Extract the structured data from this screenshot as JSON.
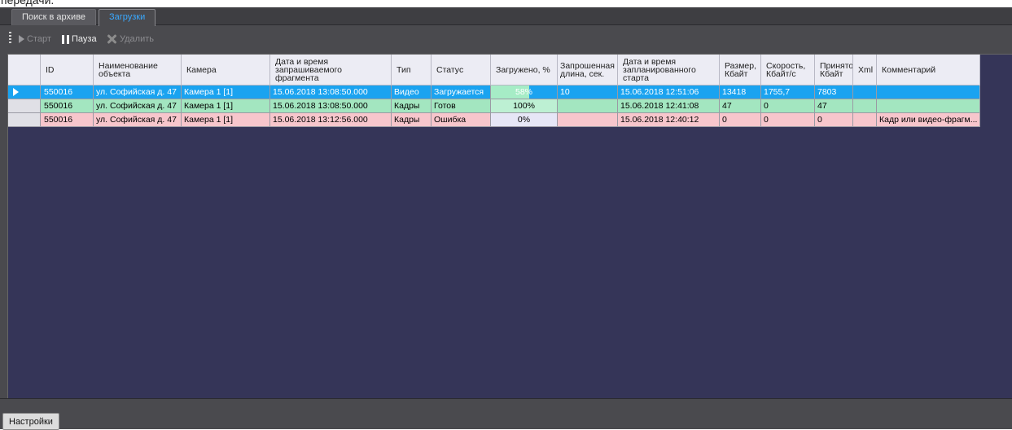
{
  "tabs": [
    {
      "label": "Поиск в архиве"
    },
    {
      "label": "Загрузки"
    }
  ],
  "toolbar": {
    "start_label": "Старт",
    "pause_label": "Пауза",
    "delete_label": "Удалить"
  },
  "table": {
    "columns": [
      "ID",
      "Наименование\nобъекта",
      "Камера",
      "Дата и время\nзапрашиваемого\nфрагмента",
      "Тип",
      "Статус",
      "Загружено, %",
      "Запрошенная\nдлина, сек.",
      "Дата и время\nзапланированного\nстарта",
      "Размер,\nКбайт",
      "Скорость,\nКбайт/с",
      "Принято,\nКбайт",
      "Xml",
      "Комментарий"
    ],
    "rows": [
      {
        "id": "550016",
        "object": "ул. Софийская д. 47",
        "camera": "Камера 1 [1]",
        "fragment_time": "15.06.2018 13:08:50.000",
        "type": "Видео",
        "status": "Загружается",
        "progress_label": "58%",
        "progress": 0.58,
        "duration": "10",
        "planned_start": "15.06.2018 12:51:06",
        "size": "13418",
        "speed": "1755,7",
        "received": "7803",
        "xml": "",
        "comment": ""
      },
      {
        "id": "550016",
        "object": "ул. Софийская д. 47",
        "camera": "Камера 1 [1]",
        "fragment_time": "15.06.2018 13:08:50.000",
        "type": "Кадры",
        "status": "Готов",
        "progress_label": "100%",
        "progress": 1.0,
        "duration": "",
        "planned_start": "15.06.2018 12:41:08",
        "size": "47",
        "speed": "0",
        "received": "47",
        "xml": "",
        "comment": ""
      },
      {
        "id": "550016",
        "object": "ул. Софийская д. 47",
        "camera": "Камера 1 [1]",
        "fragment_time": "15.06.2018 13:12:56.000",
        "type": "Кадры",
        "status": "Ошибка",
        "progress_label": "0%",
        "progress": 0.0,
        "duration": "",
        "planned_start": "15.06.2018 12:40:12",
        "size": "0",
        "speed": "0",
        "received": "0",
        "xml": "",
        "comment": "Кадр или видео-фрагм..."
      }
    ]
  },
  "bottom": {
    "settings_label": "Настройки"
  },
  "colors": {
    "accent": "#39a9ff",
    "selected_row": "#1aa3f0",
    "ready_row": "#a3e6c0",
    "error_row": "#f7c6cc",
    "grid_background": "#353558"
  }
}
